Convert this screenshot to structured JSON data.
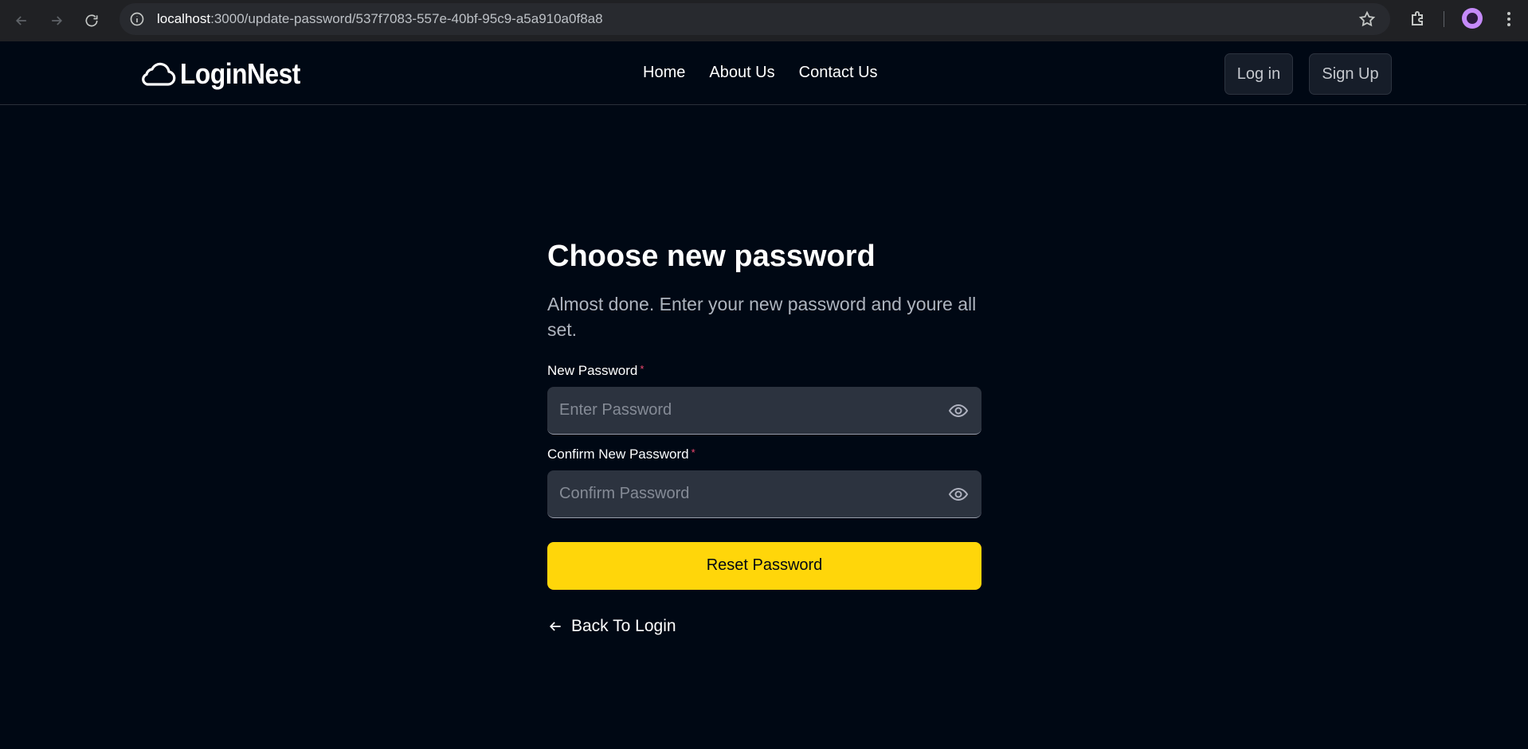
{
  "browser": {
    "url_host": "localhost",
    "url_path": ":3000/update-password/537f7083-557e-40bf-95c9-a5a910a0f8a8"
  },
  "header": {
    "logo_text": "LoginNest",
    "nav": [
      {
        "label": "Home"
      },
      {
        "label": "About Us"
      },
      {
        "label": "Contact Us"
      }
    ],
    "login_label": "Log in",
    "signup_label": "Sign Up"
  },
  "form": {
    "title": "Choose new password",
    "subtitle": "Almost done. Enter your new password and youre all set.",
    "new_password": {
      "label": "New Password",
      "required_mark": "*",
      "placeholder": "Enter Password",
      "value": ""
    },
    "confirm_password": {
      "label": "Confirm New Password",
      "required_mark": "*",
      "placeholder": "Confirm Password",
      "value": ""
    },
    "submit_label": "Reset Password",
    "back_label": "Back To Login"
  },
  "colors": {
    "background": "#000814",
    "accent": "#ffd60a",
    "input_bg": "#2c333f",
    "required": "#ef476f"
  }
}
